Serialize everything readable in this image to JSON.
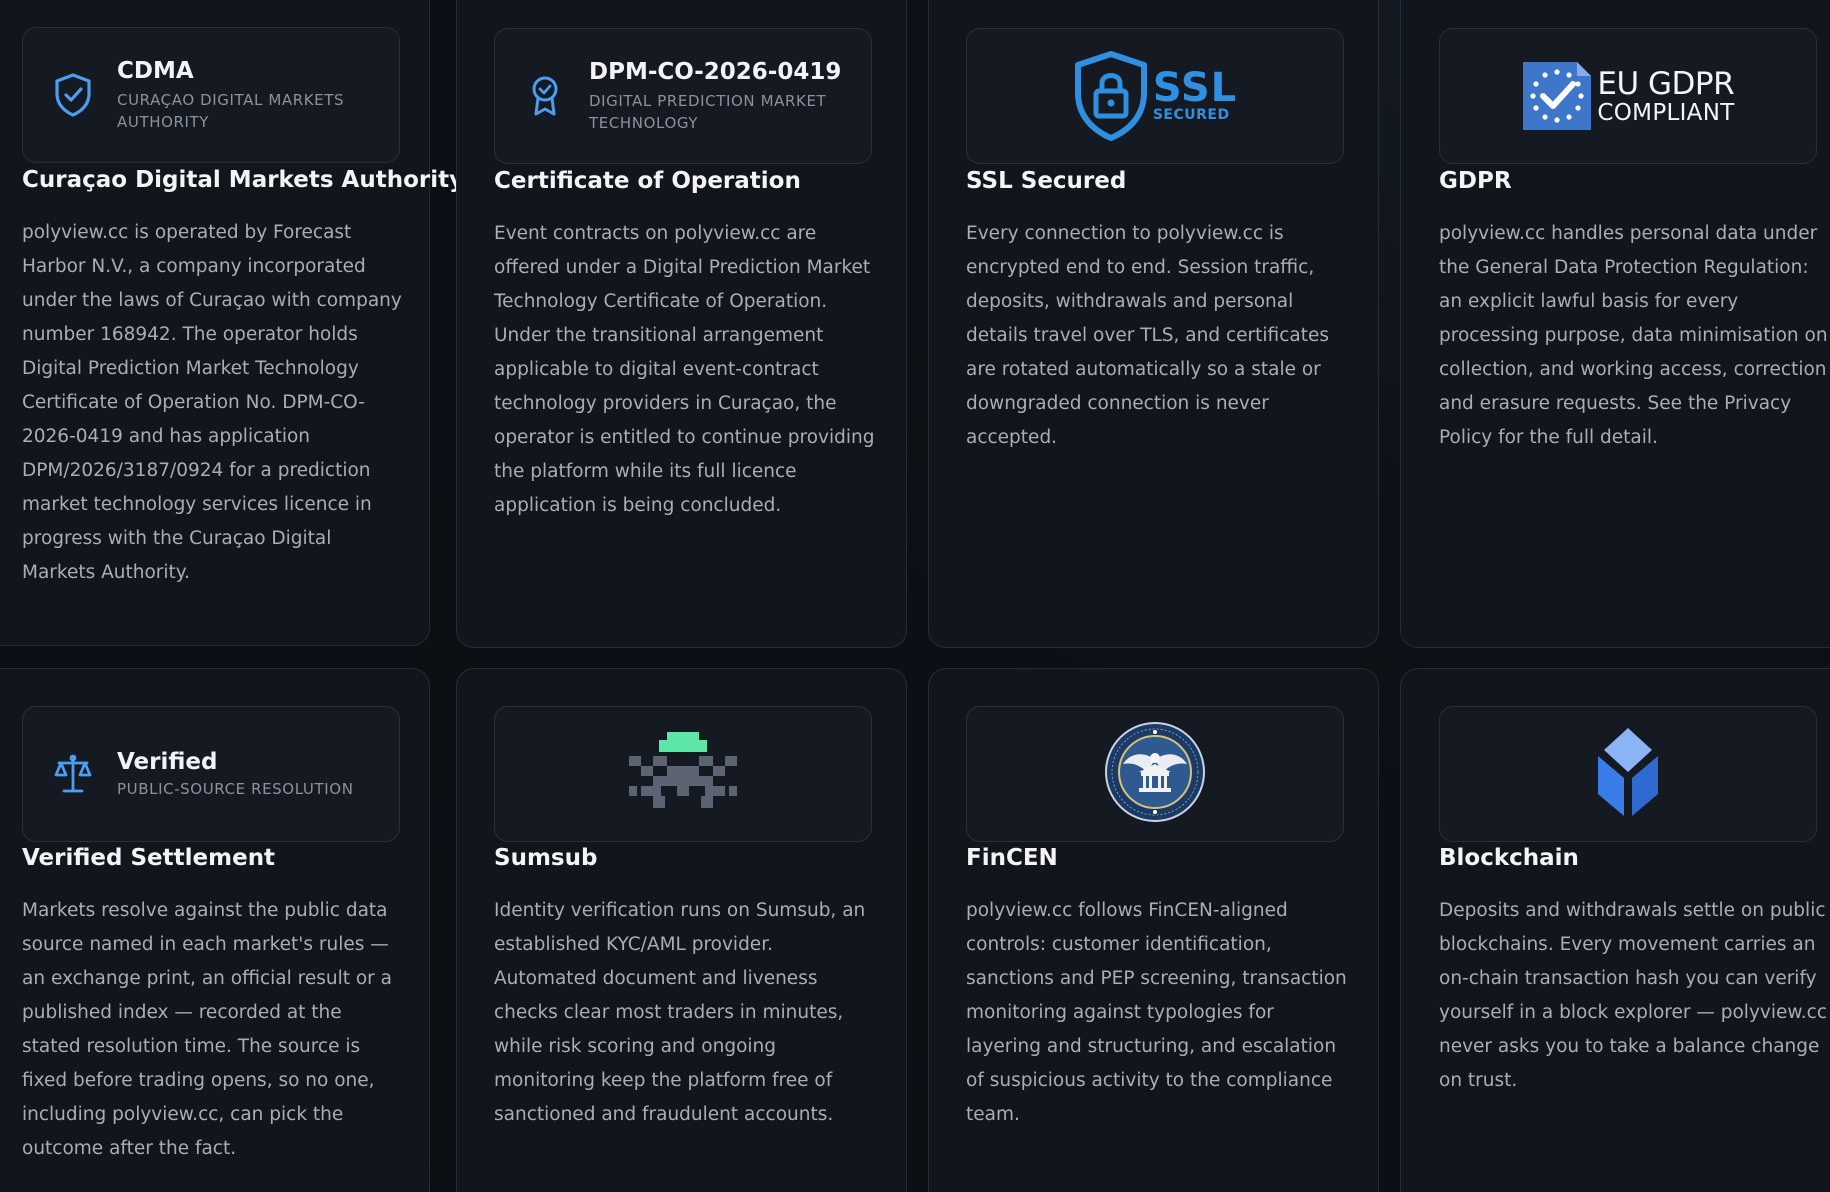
{
  "cards": [
    {
      "badge_title": "CDMA",
      "badge_sub": "CURAÇAO DIGITAL MARKETS AUTHORITY",
      "icon": "shield-check-icon",
      "title": "Curaçao Digital Markets Authority",
      "body": "polyview.cc is operated by Forecast Harbor N.V., a company incorporated under the laws of Curaçao with company number 168942. The operator holds Digital Prediction Market Technology Certificate of Operation No. DPM-CO-2026-0419 and has application DPM/2026/3187/0924 for a prediction market technology services licence in progress with the Curaçao Digital Markets Authority."
    },
    {
      "badge_title": "DPM-CO-2026-0419",
      "badge_sub": "DIGITAL PREDICTION MARKET TECHNOLOGY",
      "icon": "award-ribbon-icon",
      "title": "Certificate of Operation",
      "body": "Event contracts on polyview.cc are offered under a Digital Prediction Market Technology Certificate of Operation. Under the transitional arrangement applicable to digital event-contract technology providers in Curaçao, the operator is entitled to continue providing the platform while its full licence application is being concluded."
    },
    {
      "logo_main": "SSL",
      "logo_sub": "SECURED",
      "icon": "ssl-lock-shield-icon",
      "title": "SSL Secured",
      "body": "Every connection to polyview.cc is encrypted end to end. Session traffic, deposits, withdrawals and personal details travel over TLS, and certificates are rotated automatically so a stale or downgraded connection is never accepted."
    },
    {
      "logo_main": "EU GDPR",
      "logo_sub": "COMPLIANT",
      "icon": "eu-stars-check-icon",
      "title": "GDPR",
      "body": "polyview.cc handles personal data under the General Data Protection Regulation: an explicit lawful basis for every processing purpose, data minimisation on collection, and working access, correction and erasure requests. See the Privacy Policy for the full detail."
    },
    {
      "badge_title": "Verified",
      "badge_sub": "PUBLIC-SOURCE RESOLUTION",
      "icon": "scales-icon",
      "title": "Verified Settlement",
      "body": "Markets resolve against the public data source named in each market's rules — an exchange print, an official result or a published index — recorded at the stated resolution time. The source is fixed before trading opens, so no one, including polyview.cc, can pick the outcome after the fact."
    },
    {
      "icon": "sumsub-pixel-logo-icon",
      "title": "Sumsub",
      "body": "Identity verification runs on Sumsub, an established KYC/AML provider. Automated document and liveness checks clear most traders in minutes, while risk scoring and ongoing monitoring keep the platform free of sanctioned and fraudulent accounts."
    },
    {
      "icon": "fincen-seal-icon",
      "title": "FinCEN",
      "body": "polyview.cc follows FinCEN-aligned controls: customer identification, sanctions and PEP screening, transaction monitoring against typologies for layering and structuring, and escalation of suspicious activity to the compliance team."
    },
    {
      "icon": "blockchain-cube-icon",
      "title": "Blockchain",
      "body": "Deposits and withdrawals settle on public blockchains. Every movement carries an on-chain transaction hash you can verify yourself in a block explorer — polyview.cc never asks you to take a balance change on trust."
    }
  ],
  "colors": {
    "accent_blue": "#4a9ff2",
    "sumsub_green": "#5ee6a8",
    "blockchain_blue": "#3b7de8"
  }
}
